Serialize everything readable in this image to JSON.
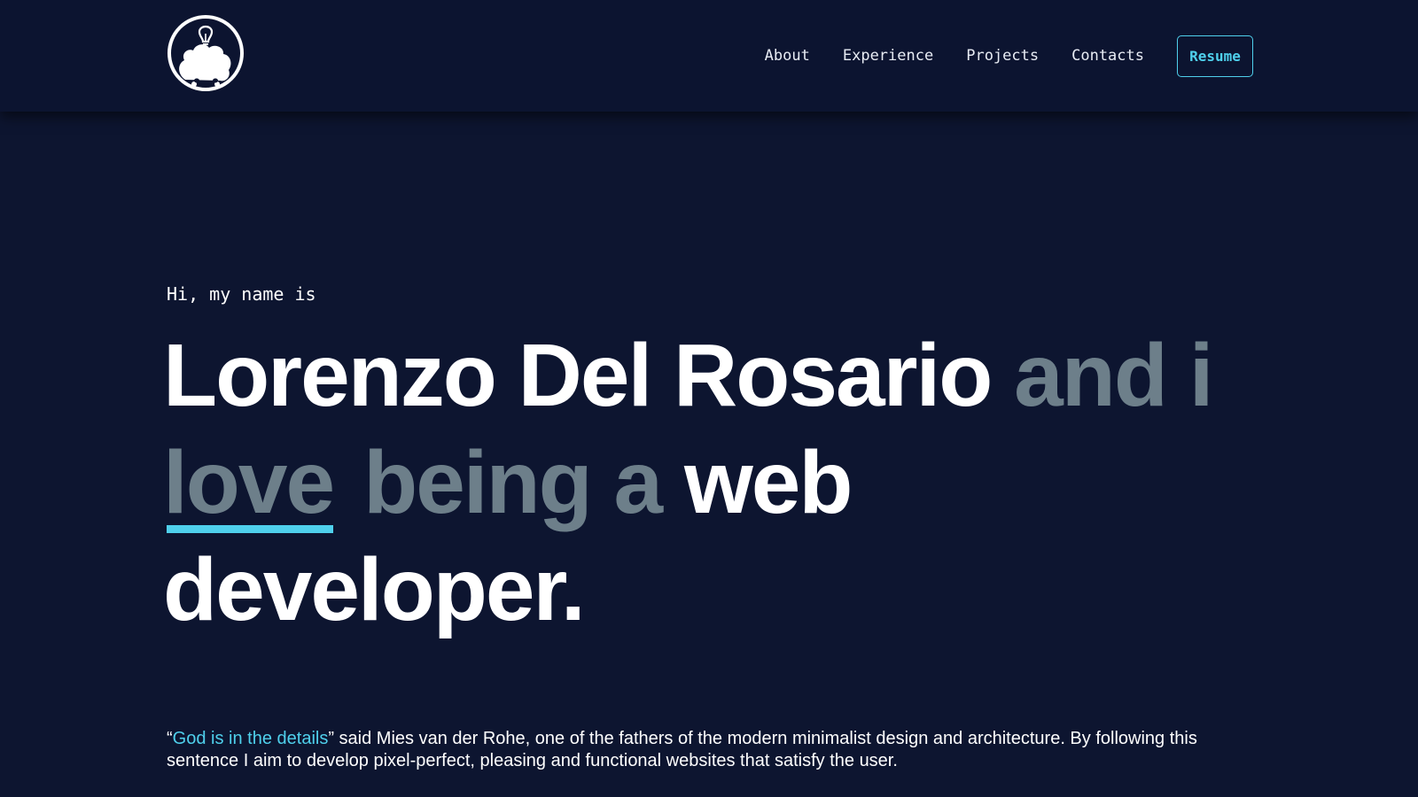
{
  "header": {
    "logo_icon": "lightbulb-head-icon",
    "nav": [
      {
        "label": "About"
      },
      {
        "label": "Experience"
      },
      {
        "label": "Projects"
      },
      {
        "label": "Contacts"
      }
    ],
    "resume_label": "Resume"
  },
  "hero": {
    "greeting": "Hi, my name is",
    "name": "Lorenzo Del Rosario",
    "headline_muted_1": "and i",
    "headline_underlined": "love",
    "headline_muted_2": "being a",
    "headline_end_1": "web",
    "headline_end_2": "developer.",
    "quote_open": "“",
    "quote_highlight": "God is in the details",
    "quote_rest": "” said Mies van der Rohe, one of the fathers of the modern minimalist design and architecture. By following this sentence I aim to develop pixel-perfect, pleasing and functional websites that satisfy the user."
  },
  "colors": {
    "background": "#0d1530",
    "accent": "#4fd0ec",
    "muted": "#6d7f8a",
    "text": "#ffffff"
  }
}
